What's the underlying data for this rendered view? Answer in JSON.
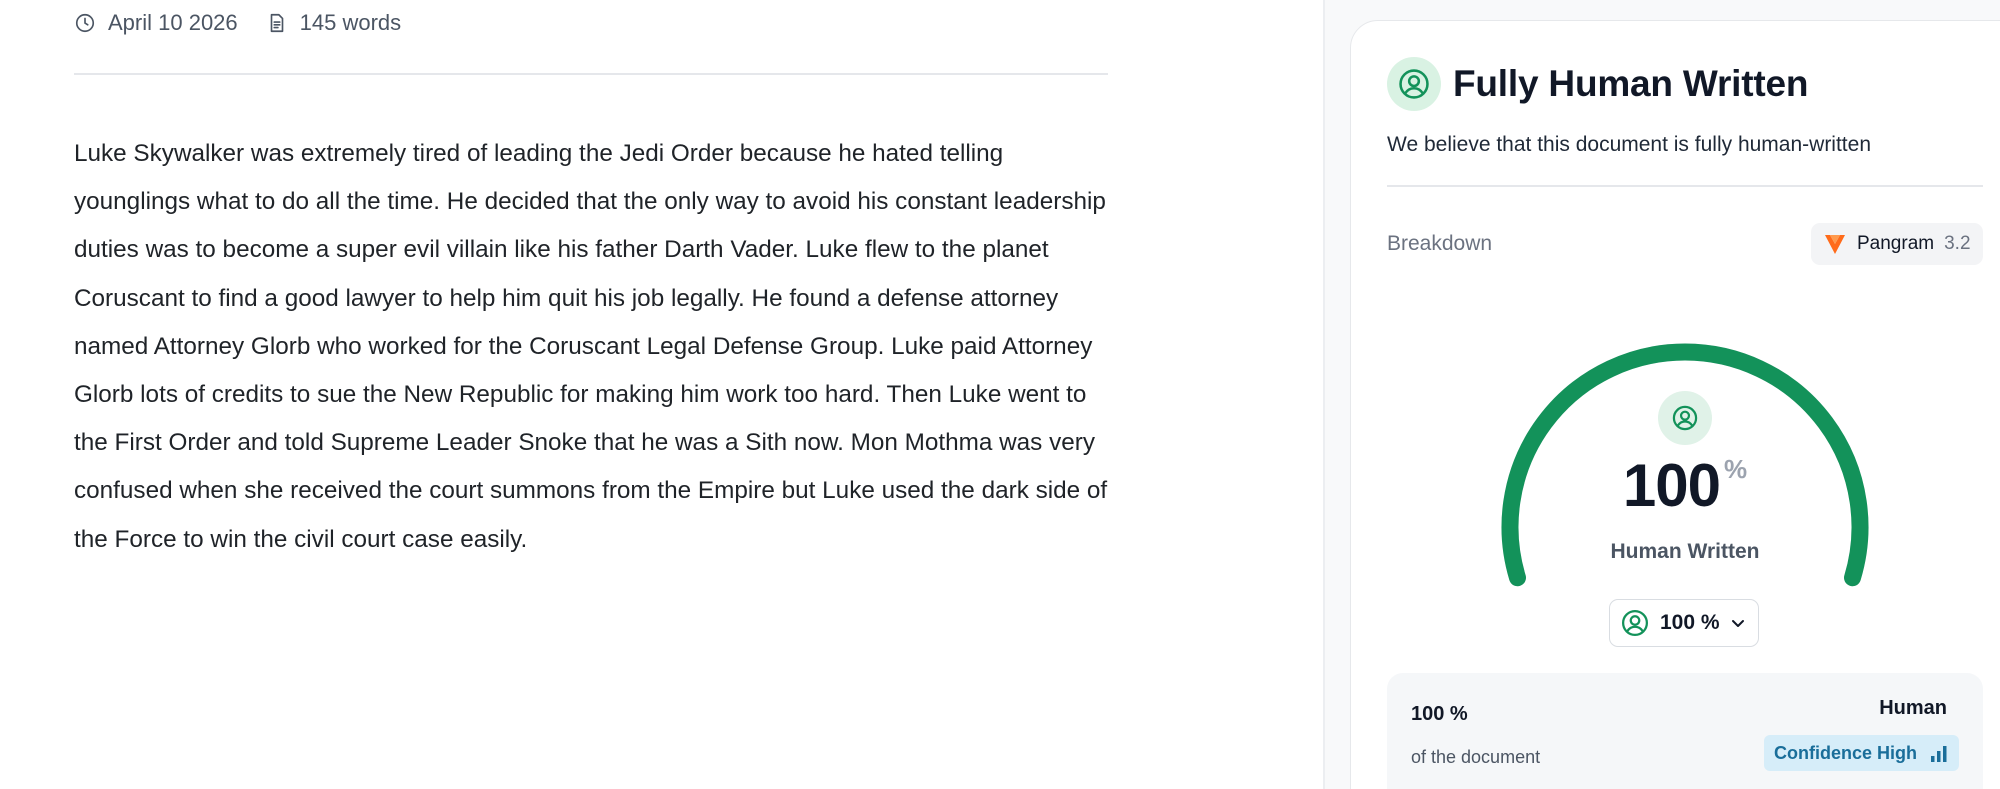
{
  "document": {
    "date": "April 10 2026",
    "word_count": "145 words",
    "text": "Luke Skywalker was extremely tired of leading the Jedi Order because he hated telling younglings what to do all the time. He decided that the only way to avoid his constant leadership duties was to become a super evil villain like his father Darth Vader. Luke flew to the planet Coruscant to find a good lawyer to help him quit his job legally. He found a defense attorney named Attorney Glorb who worked for the Coruscant Legal Defense Group. Luke paid Attorney Glorb lots of credits to sue the New Republic for making him work too hard. Then Luke went to the First Order and told Supreme Leader Snoke that he was a Sith now. Mon Mothma was very confused when she received the court summons from the Empire but Luke used the dark side of the Force to win the civil court case easily."
  },
  "result": {
    "title": "Fully Human Written",
    "subtitle": "We believe that this document is fully human-written",
    "breakdown_label": "Breakdown",
    "model_name": "Pangram",
    "model_version": "3.2",
    "gauge_value": "100",
    "gauge_unit": "%",
    "gauge_fraction": 1.0,
    "gauge_label": "Human Written",
    "dropdown_value": "100 %",
    "card_share": "100 %",
    "card_share_label": "of the document",
    "card_class": "Human",
    "confidence": "Confidence High"
  },
  "colors": {
    "accent_green": "#13925a",
    "confidence_blue": "#1a6e9a",
    "brand_orange": "#ff6b1a"
  },
  "icons": {
    "date": "clock-icon",
    "words": "document-icon",
    "human": "person-circle-icon",
    "model": "pangram-logo-icon",
    "dropdown": "chevron-down-icon",
    "confidence": "signal-bars-icon"
  }
}
